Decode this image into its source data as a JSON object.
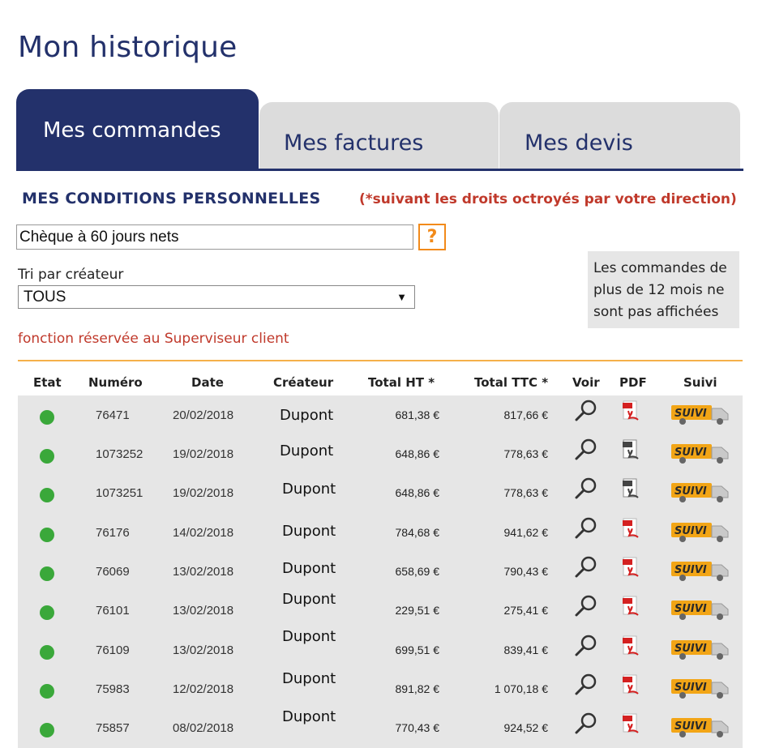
{
  "page_title": "Mon historique",
  "tabs": [
    {
      "label": "Mes commandes",
      "active": true
    },
    {
      "label": "Mes factures",
      "active": false
    },
    {
      "label": "Mes devis",
      "active": false
    }
  ],
  "conditions": {
    "title": "MES CONDITIONS PERSONNELLES",
    "note": "(*suivant les droits octroyés par votre direction)",
    "value": "Chèque à 60 jours nets",
    "help_label": "?"
  },
  "tri": {
    "label": "Tri par créateur",
    "selected": "TOUS",
    "arrow": "▼"
  },
  "info_box": [
    "Les commandes de",
    "plus de 12 mois ne",
    "sont pas affichées"
  ],
  "superviseur_note": "fonction réservée au Superviseur client",
  "columns": [
    "Etat",
    "Numéro",
    "Date",
    "Créateur",
    "Total HT *",
    "Total TTC *",
    "Voir",
    "PDF",
    "Suivi"
  ],
  "suivi_label": "SUIVI",
  "colors": {
    "brand": "#23316b",
    "accent_red": "#c0392b",
    "accent_orange": "#f28a1a",
    "status_ok": "#3aa83a",
    "suivi_truck": "#f2a516"
  },
  "orders": [
    {
      "status": "green",
      "numero": "76471",
      "date": "20/02/2018",
      "createur": "Dupont",
      "total_ht": "681,38 €",
      "total_ttc": "817,66 €",
      "pdf_icon": "pdf-red-icon"
    },
    {
      "status": "green",
      "numero": "1073252",
      "date": "19/02/2018",
      "createur": "Dupont",
      "total_ht": "648,86 €",
      "total_ttc": "778,63 €",
      "pdf_icon": "pdf-grey-icon"
    },
    {
      "status": "green",
      "numero": "1073251",
      "date": "19/02/2018",
      "createur": "Dupont",
      "total_ht": "648,86 €",
      "total_ttc": "778,63 €",
      "pdf_icon": "pdf-grey-icon"
    },
    {
      "status": "green",
      "numero": "76176",
      "date": "14/02/2018",
      "createur": "Dupont",
      "total_ht": "784,68 €",
      "total_ttc": "941,62 €",
      "pdf_icon": "pdf-red-icon"
    },
    {
      "status": "green",
      "numero": "76069",
      "date": "13/02/2018",
      "createur": "Dupont",
      "total_ht": "658,69 €",
      "total_ttc": "790,43 €",
      "pdf_icon": "pdf-red-icon"
    },
    {
      "status": "green",
      "numero": "76101",
      "date": "13/02/2018",
      "createur": "Dupont",
      "total_ht": "229,51 €",
      "total_ttc": "275,41 €",
      "pdf_icon": "pdf-red-icon"
    },
    {
      "status": "green",
      "numero": "76109",
      "date": "13/02/2018",
      "createur": "Dupont",
      "total_ht": "699,51 €",
      "total_ttc": "839,41 €",
      "pdf_icon": "pdf-red-icon"
    },
    {
      "status": "green",
      "numero": "75983",
      "date": "12/02/2018",
      "createur": "Dupont",
      "total_ht": "891,82 €",
      "total_ttc": "1 070,18 €",
      "pdf_icon": "pdf-red-icon"
    },
    {
      "status": "green",
      "numero": "75857",
      "date": "08/02/2018",
      "createur": "Dupont",
      "total_ht": "770,43 €",
      "total_ttc": "924,52 €",
      "pdf_icon": "pdf-red-icon"
    }
  ]
}
